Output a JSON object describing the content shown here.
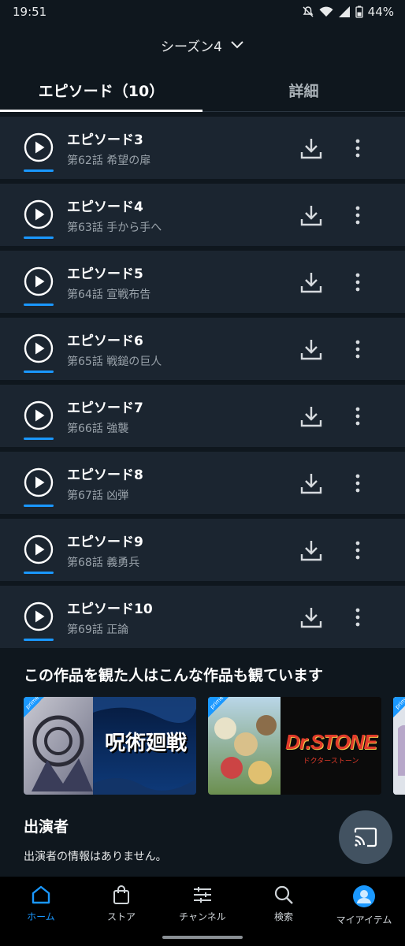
{
  "status_bar": {
    "time": "19:51",
    "battery": "44%"
  },
  "season_selector": {
    "label": "シーズン4"
  },
  "tabs": [
    {
      "label": "エピソード（10）",
      "active": true
    },
    {
      "label": "詳細",
      "active": false
    }
  ],
  "episodes": [
    {
      "title": "エピソード3",
      "subtitle": "第62話 希望の扉",
      "progress": 1.0
    },
    {
      "title": "エピソード4",
      "subtitle": "第63話 手から手へ",
      "progress": 1.0
    },
    {
      "title": "エピソード5",
      "subtitle": "第64話 宣戦布告",
      "progress": 1.0
    },
    {
      "title": "エピソード6",
      "subtitle": "第65話 戦鎚の巨人",
      "progress": 1.0
    },
    {
      "title": "エピソード7",
      "subtitle": "第66話 強襲",
      "progress": 1.0
    },
    {
      "title": "エピソード8",
      "subtitle": "第67話 凶弾",
      "progress": 1.0
    },
    {
      "title": "エピソード9",
      "subtitle": "第68話 義勇兵",
      "progress": 1.0
    },
    {
      "title": "エピソード10",
      "subtitle": "第69話 正論",
      "progress": 1.0
    }
  ],
  "recommendations": {
    "title": "この作品を観た人はこんな作品も観ています",
    "items": [
      {
        "logo_text": "呪術廻戦",
        "badge": "prime"
      },
      {
        "logo_text": "Dr.STONE",
        "logo_sub": "ドクターストーン",
        "badge": "prime"
      },
      {
        "badge": "prime"
      }
    ]
  },
  "cast": {
    "title": "出演者",
    "message": "出演者の情報はありません。"
  },
  "bottom_nav": [
    {
      "label": "ホーム",
      "icon": "home-icon",
      "active": true
    },
    {
      "label": "ストア",
      "icon": "store-bag-icon",
      "active": false
    },
    {
      "label": "チャンネル",
      "icon": "channels-sliders-icon",
      "active": false
    },
    {
      "label": "検索",
      "icon": "search-icon",
      "active": false
    },
    {
      "label": "マイアイテム",
      "icon": "profile-avatar-icon",
      "active": false
    }
  ],
  "colors": {
    "background": "#0f171e",
    "row_background": "#1b2530",
    "accent": "#1a98ff",
    "subtitle": "#9aa3ab"
  }
}
